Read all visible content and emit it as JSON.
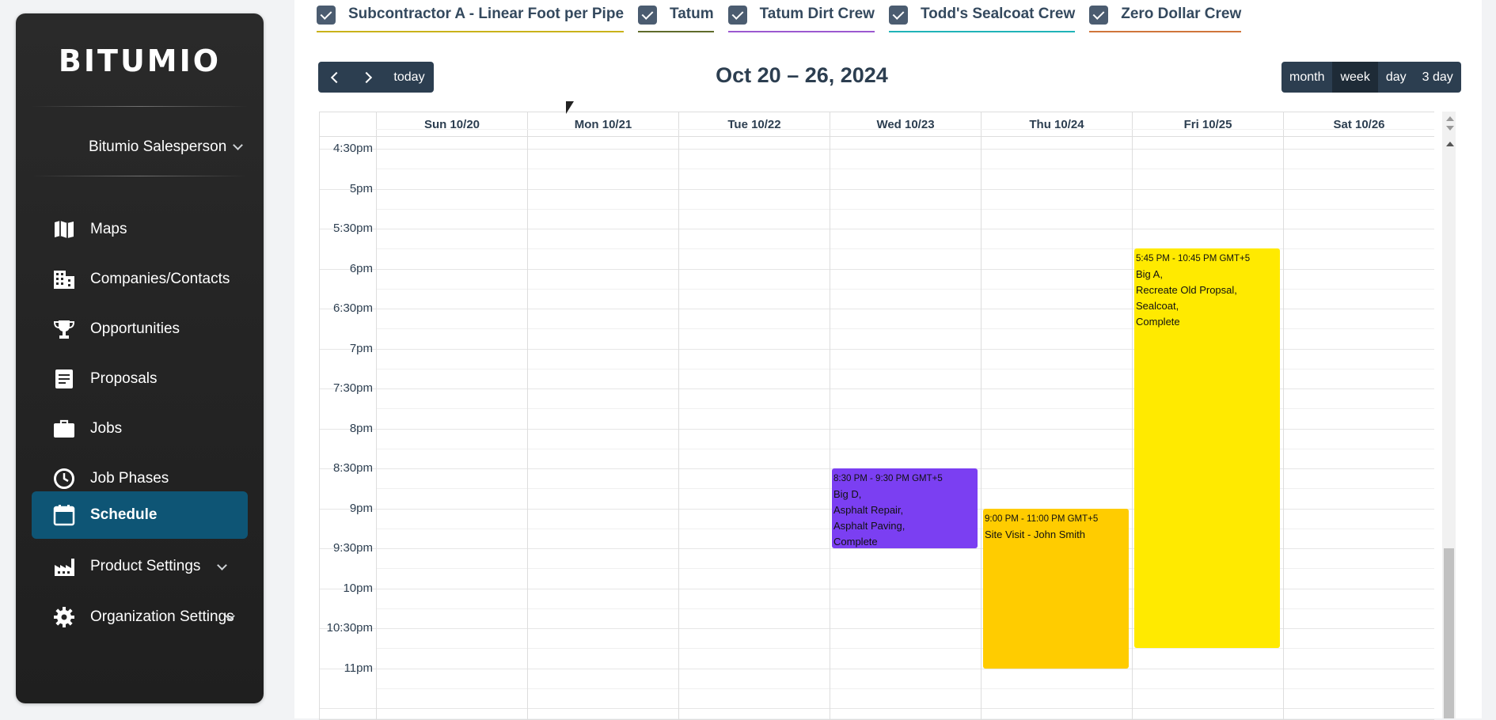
{
  "app": {
    "brand": "BITUMIO"
  },
  "sidebar": {
    "user": "Bitumio Salesperson",
    "items": [
      {
        "label": "Maps",
        "icon": "map-icon"
      },
      {
        "label": "Companies/Contacts",
        "icon": "building-icon"
      },
      {
        "label": "Opportunities",
        "icon": "trophy-icon"
      },
      {
        "label": "Proposals",
        "icon": "document-icon"
      },
      {
        "label": "Jobs",
        "icon": "briefcase-icon"
      },
      {
        "label": "Job Phases",
        "icon": "clock-icon"
      },
      {
        "label": "Schedule",
        "icon": "calendar-icon",
        "active": true
      },
      {
        "label": "Product Settings",
        "icon": "factory-icon"
      },
      {
        "label": "Organization Settings",
        "icon": "gear-icon"
      }
    ]
  },
  "filters": [
    {
      "label": "Subcontractor A - Linear Foot per Pipe",
      "checked": true,
      "color": "#c9b21a"
    },
    {
      "label": "Tatum",
      "checked": true,
      "color": "#5f6b2a"
    },
    {
      "label": "Tatum Dirt Crew",
      "checked": true,
      "color": "#9b59d0"
    },
    {
      "label": "Todd's Sealcoat Crew",
      "checked": true,
      "color": "#1fb3b8"
    },
    {
      "label": "Zero Dollar Crew",
      "checked": true,
      "color": "#d0753a"
    }
  ],
  "toolbar": {
    "today": "today",
    "title": "Oct 20 – 26, 2024",
    "views": [
      "month",
      "week",
      "day",
      "3 day"
    ],
    "active_view": "week"
  },
  "calendar": {
    "days": [
      "Sun 10/20",
      "Mon 10/21",
      "Tue 10/22",
      "Wed 10/23",
      "Thu 10/24",
      "Fri 10/25",
      "Sat 10/26"
    ],
    "times": [
      "4:30pm",
      "5pm",
      "5:30pm",
      "6pm",
      "6:30pm",
      "7pm",
      "7:30pm",
      "8pm",
      "8:30pm",
      "9pm",
      "9:30pm",
      "10pm",
      "10:30pm",
      "11pm"
    ],
    "events": [
      {
        "day": 3,
        "start": "20:30",
        "end": "21:30",
        "time": "8:30 PM - 9:30 PM GMT+5",
        "title": "Big D,\nAsphalt Repair,\nAsphalt Paving,\nComplete",
        "color": "#7b3ff2",
        "text_color": "#111111"
      },
      {
        "day": 4,
        "start": "21:00",
        "end": "23:00",
        "time": "9:00 PM - 11:00 PM GMT+5",
        "title": "Site Visit - John Smith",
        "color": "#ffcc00",
        "text_color": "#111111"
      },
      {
        "day": 5,
        "start": "17:45",
        "end": "22:45",
        "time": "5:45 PM - 10:45 PM GMT+5",
        "title": "Big A,\nRecreate Old Propsal,\nSealcoat,\nComplete",
        "color": "#ffea00",
        "text_color": "#111111"
      }
    ]
  }
}
